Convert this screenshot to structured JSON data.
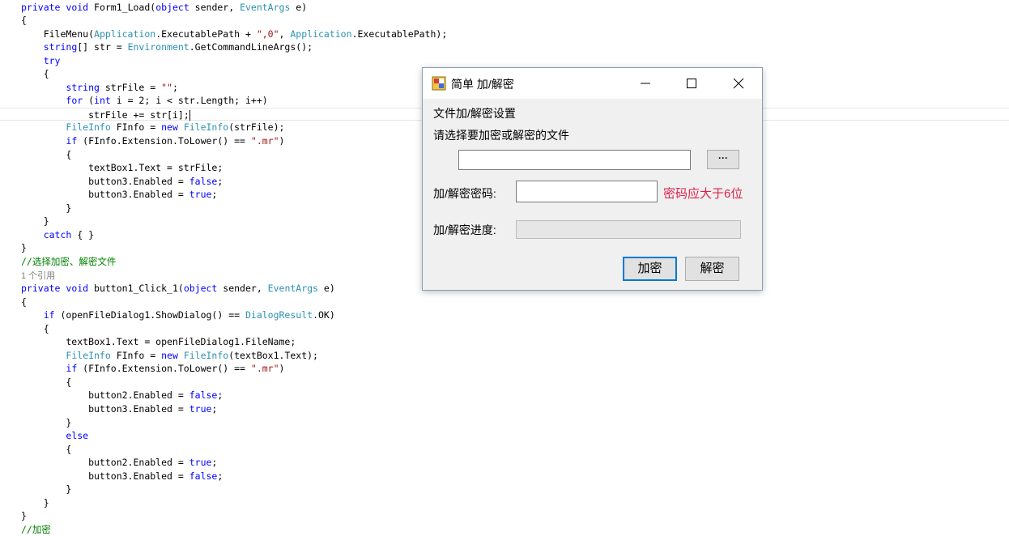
{
  "editor": {
    "lines": [
      {
        "html": "<span class=\"k\">private</span> <span class=\"k\">void</span> Form1_Load(<span class=\"k\">object</span> sender, <span class=\"t\">EventArgs</span> e)"
      },
      {
        "html": "{"
      },
      {
        "html": "    FileMenu(<span class=\"t\">Application</span>.ExecutablePath + <span class=\"s\">\",0\"</span>, <span class=\"t\">Application</span>.ExecutablePath);"
      },
      {
        "html": "    <span class=\"k\">string</span>[] str = <span class=\"t\">Environment</span>.GetCommandLineArgs();"
      },
      {
        "html": "    <span class=\"k\">try</span>"
      },
      {
        "html": "    {"
      },
      {
        "html": "        <span class=\"k\">string</span> strFile = <span class=\"s\">\"\"</span>;"
      },
      {
        "html": "        <span class=\"k\">for</span> (<span class=\"k\">int</span> i = 2; i &lt; str.Length; i++)"
      },
      {
        "html": "            strFile += str[i];<span class=\"caret\"></span>",
        "current": true
      },
      {
        "html": "        <span class=\"t\">FileInfo</span> FInfo = <span class=\"k\">new</span> <span class=\"t\">FileInfo</span>(strFile);"
      },
      {
        "html": "        <span class=\"k\">if</span> (FInfo.Extension.ToLower() == <span class=\"s\">\".mr\"</span>)"
      },
      {
        "html": "        {"
      },
      {
        "html": "            textBox1.Text = strFile;"
      },
      {
        "html": "            button3.Enabled = <span class=\"k\">false</span>;"
      },
      {
        "html": "            button3.Enabled = <span class=\"k\">true</span>;"
      },
      {
        "html": "        }"
      },
      {
        "html": "    }"
      },
      {
        "html": "    <span class=\"k\">catch</span> { }"
      },
      {
        "html": "}"
      },
      {
        "html": "<span class=\"c\">//选择加密、解密文件</span>"
      },
      {
        "html": "<span class=\"r\">1 个引用</span>"
      },
      {
        "html": "<span class=\"k\">private</span> <span class=\"k\">void</span> button1_Click_1(<span class=\"k\">object</span> sender, <span class=\"t\">EventArgs</span> e)"
      },
      {
        "html": "{"
      },
      {
        "html": "    <span class=\"k\">if</span> (openFileDialog1.ShowDialog() == <span class=\"t\">DialogResult</span>.OK)"
      },
      {
        "html": "    {"
      },
      {
        "html": "        textBox1.Text = openFileDialog1.FileName;"
      },
      {
        "html": "        <span class=\"t\">FileInfo</span> FInfo = <span class=\"k\">new</span> <span class=\"t\">FileInfo</span>(textBox1.Text);"
      },
      {
        "html": "        <span class=\"k\">if</span> (FInfo.Extension.ToLower() == <span class=\"s\">\".mr\"</span>)"
      },
      {
        "html": "        {"
      },
      {
        "html": "            button2.Enabled = <span class=\"k\">false</span>;"
      },
      {
        "html": "            button3.Enabled = <span class=\"k\">true</span>;"
      },
      {
        "html": "        }"
      },
      {
        "html": "        <span class=\"k\">else</span>"
      },
      {
        "html": "        {"
      },
      {
        "html": "            button2.Enabled = <span class=\"k\">true</span>;"
      },
      {
        "html": "            button3.Enabled = <span class=\"k\">false</span>;"
      },
      {
        "html": "        }"
      },
      {
        "html": "    }"
      },
      {
        "html": "}"
      },
      {
        "html": "<span class=\"c\">//加密</span>"
      }
    ]
  },
  "dialog": {
    "title": "简单 加/解密",
    "app_icon": "app-icon",
    "section_title": "文件加/解密设置",
    "choose_label": "请选择要加密或解密的文件",
    "file_value": "",
    "browse_label": "···",
    "password_label": "加/解密密码:",
    "password_value": "",
    "password_hint": "密码应大于6位",
    "progress_label": "加/解密进度:",
    "progress": 0,
    "encrypt_label": "加密",
    "decrypt_label": "解密"
  },
  "colors": {
    "keyword": "#0000ff",
    "type": "#2b91af",
    "string": "#a31515",
    "comment": "#008000",
    "hint": "#e0204a",
    "focus": "#0078d7"
  }
}
